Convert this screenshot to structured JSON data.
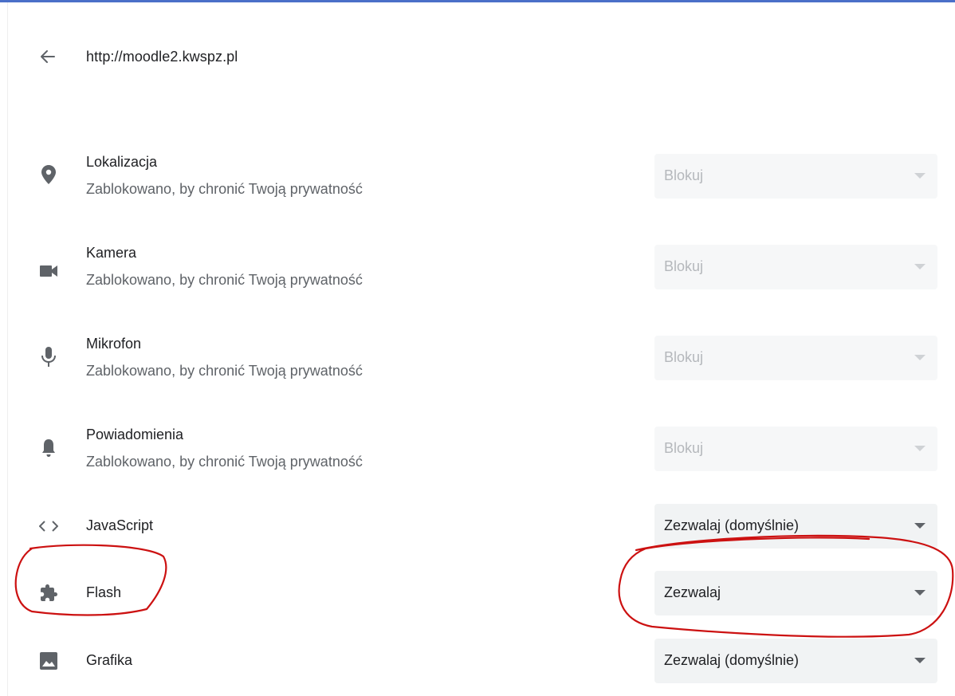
{
  "header": {
    "url": "http://moodle2.kwspz.pl"
  },
  "icons": {
    "back": "arrow-left-icon",
    "location": "location-pin-icon",
    "camera": "videocam-icon",
    "mic": "microphone-icon",
    "notifications": "bell-icon",
    "javascript": "code-brackets-icon",
    "flash": "puzzle-piece-icon",
    "images": "image-icon"
  },
  "permissions": [
    {
      "title": "Lokalizacja",
      "subtitle": "Zablokowano, by chronić Twoją prywatność",
      "value": "Blokuj",
      "disabled": true
    },
    {
      "title": "Kamera",
      "subtitle": "Zablokowano, by chronić Twoją prywatność",
      "value": "Blokuj",
      "disabled": true
    },
    {
      "title": "Mikrofon",
      "subtitle": "Zablokowano, by chronić Twoją prywatność",
      "value": "Blokuj",
      "disabled": true
    },
    {
      "title": "Powiadomienia",
      "subtitle": "Zablokowano, by chronić Twoją prywatność",
      "value": "Blokuj",
      "disabled": true
    },
    {
      "title": "JavaScript",
      "value": "Zezwalaj (domyślnie)",
      "disabled": false
    },
    {
      "title": "Flash",
      "value": "Zezwalaj",
      "disabled": false
    },
    {
      "title": "Grafika",
      "value": "Zezwalaj (domyślnie)",
      "disabled": false
    }
  ],
  "colors": {
    "accent_line": "#4a6fc8",
    "annotation": "#cc1111",
    "select_bg": "#f1f3f4",
    "icon": "#5f6368"
  }
}
